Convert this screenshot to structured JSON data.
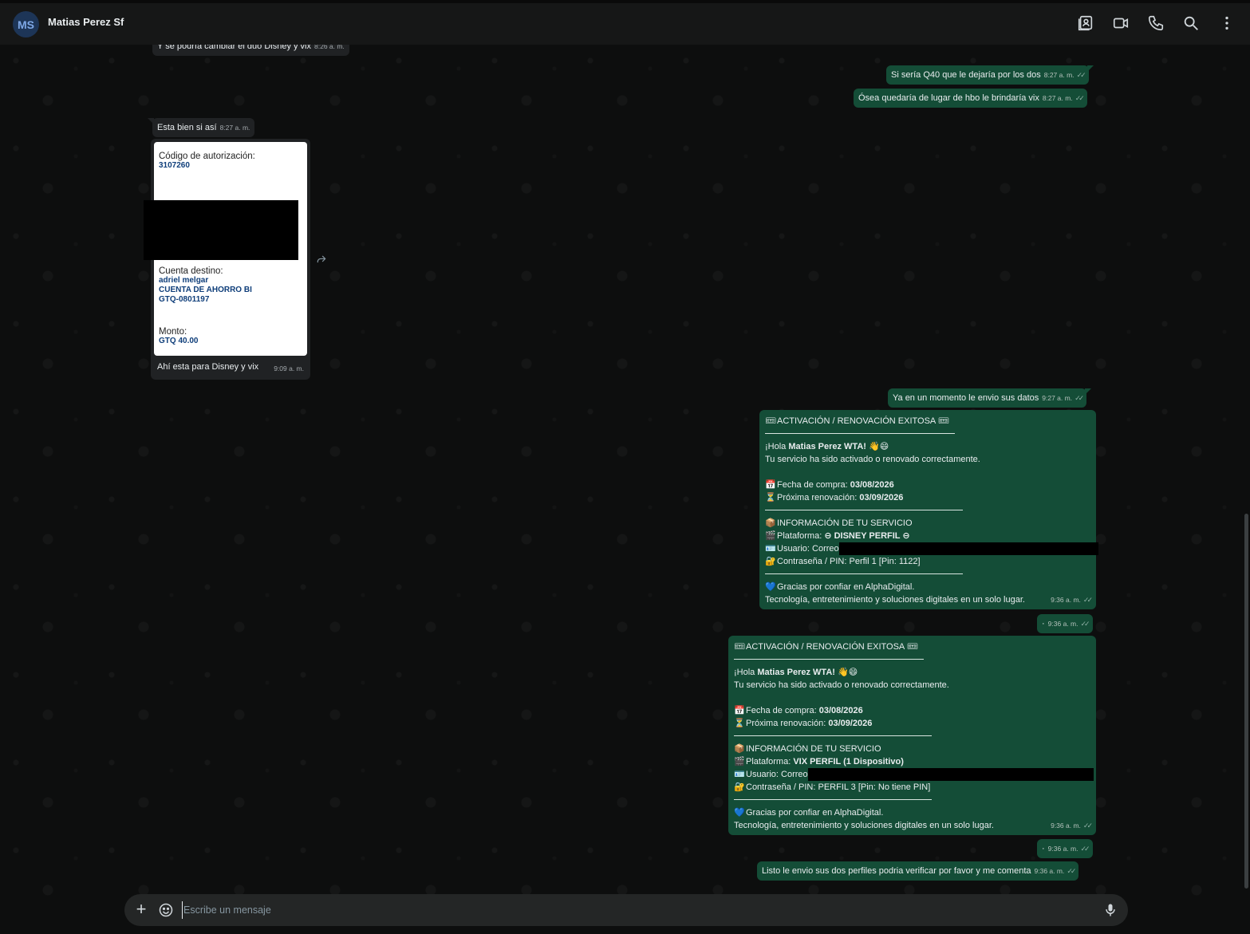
{
  "header": {
    "avatar_initials": "MS",
    "contact_name": "Matias Perez Sf",
    "icons": [
      "contact-card-icon",
      "video-call-icon",
      "voice-call-icon",
      "search-icon",
      "menu-dots-icon"
    ]
  },
  "messages": {
    "m1": {
      "text": "Y se podría cambiar el duo Disney y vix",
      "time": "8:26 a. m."
    },
    "m2": {
      "text": "Si sería Q40 que le dejaría por los dos",
      "time": "8:27 a. m."
    },
    "m3": {
      "text": "Ósea quedaría de lugar de hbo le brindaría vix",
      "time": "8:27 a. m."
    },
    "m4": {
      "text": "Esta bien si así",
      "time": "8:27 a. m."
    },
    "receipt": {
      "auth_label": "Código de autorización:",
      "auth_value": "3107260",
      "dest_label": "Cuenta destino:",
      "dest_name": "adriel melgar",
      "dest_account_type": "CUENTA DE AHORRO BI",
      "dest_account_number": "GTQ-0801197",
      "amount_label": "Monto:",
      "amount_value": "GTQ 40.00",
      "caption": "Ahí esta para Disney y vix",
      "time": "9:09 a. m."
    },
    "m5": {
      "text": "Ya en un momento le envio sus datos",
      "time": "9:27 a. m."
    },
    "t1": {
      "title": "ACTIVACIÓN / RENOVACIÓN EXITOSA",
      "greet_pre": "¡Hola ",
      "greet_name": "Matias Perez WTA!",
      "greet_line": "Tu servicio ha sido activado o renovado correctamente.",
      "purchase_label": "Fecha de compra: ",
      "purchase_date": "03/08/2026",
      "renew_label": "Próxima renovación: ",
      "renew_date": "03/09/2026",
      "info_title": "INFORMACIÓN DE TU SERVICIO",
      "platform_label": "Plataforma: ",
      "platform_value": "⊖ DISNEY PERFIL ⊖",
      "user_label": "Usuario: Correo",
      "pass_line": "Contraseña / PIN: Perfil 1 [Pin: 1122]",
      "thanks": "Gracias por confiar en AlphaDigital.",
      "tagline": "Tecnología, entretenimiento y soluciones digitales en un solo lugar.",
      "time": "9:36 a. m."
    },
    "m6": {
      "text": "·",
      "time": "9:36 a. m."
    },
    "t2": {
      "title": "ACTIVACIÓN / RENOVACIÓN EXITOSA",
      "greet_pre": "¡Hola ",
      "greet_name": "Matias Perez WTA!",
      "greet_line": "Tu servicio ha sido activado o renovado correctamente.",
      "purchase_label": "Fecha de compra: ",
      "purchase_date": "03/08/2026",
      "renew_label": "Próxima renovación: ",
      "renew_date": "03/09/2026",
      "info_title": "INFORMACIÓN DE TU SERVICIO",
      "platform_label": "Plataforma: ",
      "platform_value": "VIX PERFIL (1 Dispositivo)",
      "user_label": "Usuario: Correo",
      "pass_line": "Contraseña / PIN: PERFIL 3 [Pin: No tiene PIN]",
      "thanks": "Gracias por confiar en AlphaDigital.",
      "tagline": "Tecnología, entretenimiento y soluciones digitales en un solo lugar.",
      "time": "9:36 a. m."
    },
    "m7": {
      "text": "·",
      "time": "9:36 a. m."
    },
    "m8": {
      "text": "Listo le envio sus dos perfiles podria verificar por favor y me comenta",
      "time": "9:36 a. m."
    }
  },
  "composer": {
    "placeholder": "Escribe un mensaje"
  },
  "colors": {
    "outgoing_bubble": "#144d37",
    "incoming_bubble": "#202224",
    "header_bg": "#161717"
  }
}
